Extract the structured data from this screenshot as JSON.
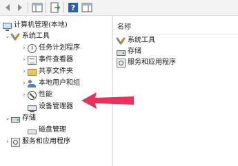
{
  "toolbar": {
    "buttons": [
      {
        "name": "back-button",
        "icon": "arrow-left-icon"
      },
      {
        "name": "forward-button",
        "icon": "arrow-right-icon"
      },
      {
        "name": "show-hide-tree-button",
        "icon": "panel-icon"
      },
      {
        "name": "export-list-button",
        "icon": "export-icon"
      },
      {
        "name": "help-button",
        "icon": "help-icon",
        "label": "?"
      },
      {
        "name": "action-pane-button",
        "icon": "panel-icon"
      }
    ]
  },
  "tree": {
    "root": "计算机管理(本地)",
    "system_tools": "系统工具",
    "task_scheduler": "任务计划程序",
    "event_viewer": "事件查看器",
    "shared_folders": "共享文件夹",
    "local_users": "本地用户和组",
    "performance": "性能",
    "device_manager": "设备管理器",
    "storage": "存储",
    "disk_management": "磁盘管理",
    "services_apps": "服务和应用程序"
  },
  "right": {
    "column_header": "名称",
    "items": [
      "系统工具",
      "存储",
      "服务和应用程序"
    ]
  },
  "colors": {
    "arrow": "#e8335e",
    "accent": "#4a6fa5"
  }
}
